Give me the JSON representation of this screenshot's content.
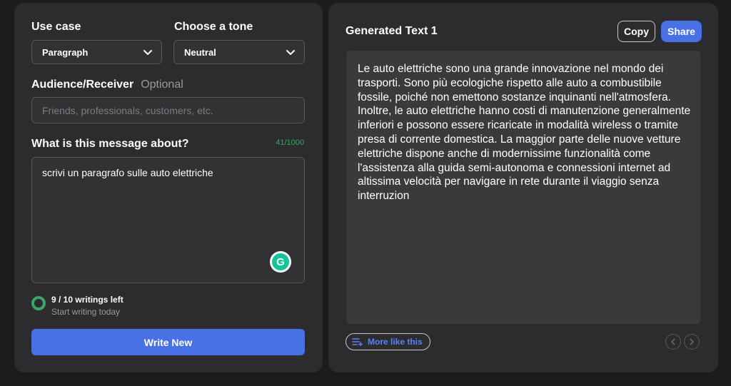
{
  "form": {
    "use_case_label": "Use case",
    "use_case_value": "Paragraph",
    "tone_label": "Choose a tone",
    "tone_value": "Neutral",
    "audience_label": "Audience/Receiver",
    "audience_optional": "Optional",
    "audience_placeholder": "Friends, professionals, customers, etc.",
    "message_label": "What is this message about?",
    "message_counter": "41/1000",
    "message_value": "scrivi un paragrafo sulle auto elettriche",
    "usage_main": "9 / 10 writings left",
    "usage_sub": "Start writing today",
    "usage_fraction": 0.9,
    "write_button": "Write New"
  },
  "output": {
    "title": "Generated Text 1",
    "copy_label": "Copy",
    "share_label": "Share",
    "text": "Le auto elettriche sono una grande innovazione nel mondo dei trasporti. Sono più ecologiche rispetto alle auto a combustibile fossile, poiché non emettono sostanze inquinanti nell'atmosfera. Inoltre, le auto elettriche hanno costi di manutenzione generalmente inferiori e possono essere ricaricate in modalità wireless o tramite presa di corrente domestica. La maggior parte delle nuove vetture elettriche dispone anche di modernissime funzionalità come l'assistenza alla guida semi-autonoma e connessioni internet ad altissima velocità per navigare in rete durante il viaggio senza interruzion",
    "more_label": "More like this"
  },
  "colors": {
    "accent": "#4a70e6",
    "success": "#3aa46a",
    "panel": "#2c2c2e"
  },
  "icons": [
    "chevron-down-icon",
    "grammarly-icon",
    "progress-ring-icon",
    "list-add-icon",
    "chevron-left-icon",
    "chevron-right-icon"
  ]
}
